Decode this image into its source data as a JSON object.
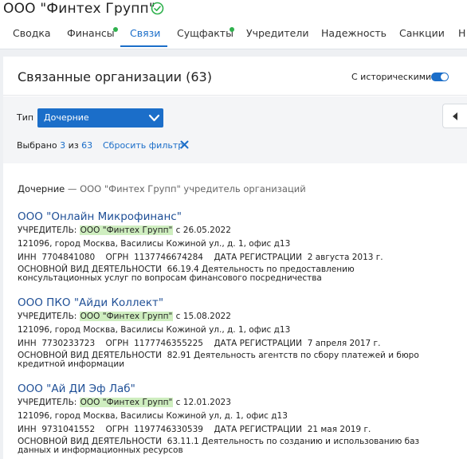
{
  "header": {
    "company_title": "ООО \"Финтех Групп\"",
    "verified_icon": "check-circle-icon",
    "tabs": [
      {
        "label": "Сводка",
        "active": false,
        "dot": false
      },
      {
        "label": "Финансы",
        "active": false,
        "dot": true
      },
      {
        "label": "Связи",
        "active": true,
        "dot": false
      },
      {
        "label": "Сущфакты",
        "active": false,
        "dot": true
      },
      {
        "label": "Учредители",
        "active": false,
        "dot": false
      },
      {
        "label": "Надежность",
        "active": false,
        "dot": false
      },
      {
        "label": "Санкции",
        "active": false,
        "dot": false
      },
      {
        "label": "Н",
        "active": false,
        "dot": false
      }
    ]
  },
  "panel": {
    "title": "Связанные организации (63)",
    "historical_label": "С историческими",
    "historical_on": true
  },
  "filter": {
    "type_label": "Тип",
    "type_value": "Дочерние",
    "selected_prefix": "Выбрано",
    "selected_count": "3",
    "selected_of": "из",
    "selected_total": "63",
    "reset_label": "Сбросить фильтр"
  },
  "section": {
    "heading": "Дочерние",
    "note": "— ООО \"Финтех Групп\" учредитель организаций"
  },
  "labels": {
    "founder": "УЧРЕДИТЕЛЬ:",
    "inn": "ИНН",
    "ogrn": "ОГРН",
    "reg_date": "ДАТА РЕГИСТРАЦИИ",
    "main_activity": "ОСНОВНОЙ ВИД ДЕЯТЕЛЬНОСТИ"
  },
  "orgs": [
    {
      "name": "ООО \"Онлайн Микрофинанс\"",
      "founder": "ООО \"Финтех Групп\"",
      "since": "с 26.05.2022",
      "address": "121096, город Москва, Василисы Кожиной ул., д. 1, офис д13",
      "inn": "7704841080",
      "ogrn": "1137746674284",
      "reg_date": "2 августа 2013 г.",
      "activity": "66.19.4 Деятельность по предоставлению консультационных услуг по вопросам финансового посредничества"
    },
    {
      "name": "ООО ПКО \"Айди Коллект\"",
      "founder": "ООО \"Финтех Групп\"",
      "since": "с 15.08.2022",
      "address": "121096, город Москва, Василисы Кожиной ул., д. 1, офис д13",
      "inn": "7730233723",
      "ogrn": "1177746355225",
      "reg_date": "7 апреля 2017 г.",
      "activity": "82.91 Деятельность агентств по сбору платежей и бюро кредитной информации"
    },
    {
      "name": "ООО \"Ай ДИ Эф Лаб\"",
      "founder": "ООО \"Финтех Групп\"",
      "since": "с 12.01.2023",
      "address": "121096, город Москва, Василисы Кожиной ул, д. 1, офис д13",
      "inn": "9731041552",
      "ogrn": "1197746330539",
      "reg_date": "21 мая 2019 г.",
      "activity": "63.11.1 Деятельность по созданию и использованию баз данных и информационных ресурсов"
    }
  ]
}
